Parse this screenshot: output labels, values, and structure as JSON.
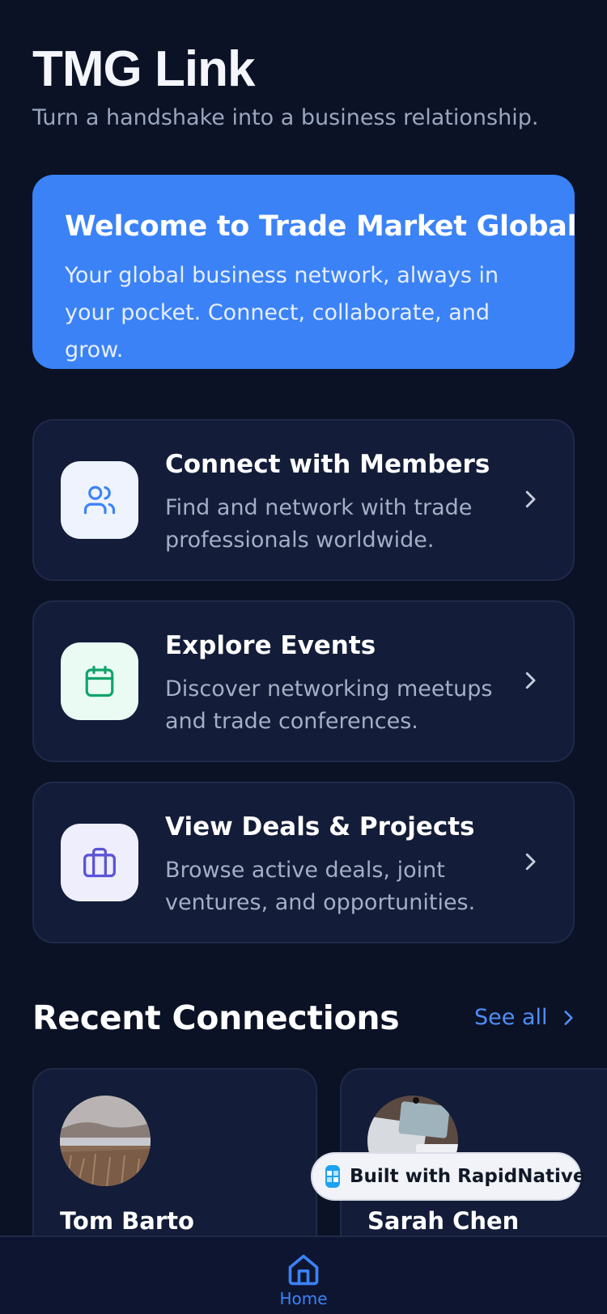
{
  "header": {
    "title": "TMG Link",
    "subtitle": "Turn a handshake into a business relationship."
  },
  "welcome": {
    "title": "Welcome to Trade Market Global",
    "text": "Your global business network, always in your pocket. Connect, collaborate, and grow."
  },
  "features": [
    {
      "title": "Connect with Members",
      "description": "Find and network with trade professionals worldwide.",
      "icon": "users-icon",
      "icon_color": "#3b82f6",
      "icon_bg": "#eef3fe"
    },
    {
      "title": "Explore Events",
      "description": "Discover networking meetups and trade conferences.",
      "icon": "calendar-icon",
      "icon_color": "#10a36b",
      "icon_bg": "#e9fbf3"
    },
    {
      "title": "View Deals & Projects",
      "description": "Browse active deals, joint ventures, and opportunities.",
      "icon": "briefcase-icon",
      "icon_color": "#5b54d6",
      "icon_bg": "#eeeefc"
    }
  ],
  "recent": {
    "title": "Recent Connections",
    "see_all": "See all",
    "connections": [
      {
        "name": "Tom Barto"
      },
      {
        "name": "Sarah Chen"
      }
    ]
  },
  "badge": {
    "label": "Built with RapidNative"
  },
  "tab_bar": {
    "home_label": "Home"
  },
  "colors": {
    "background": "#0b1226",
    "card": "#131c38",
    "accent": "#3b82f6"
  }
}
